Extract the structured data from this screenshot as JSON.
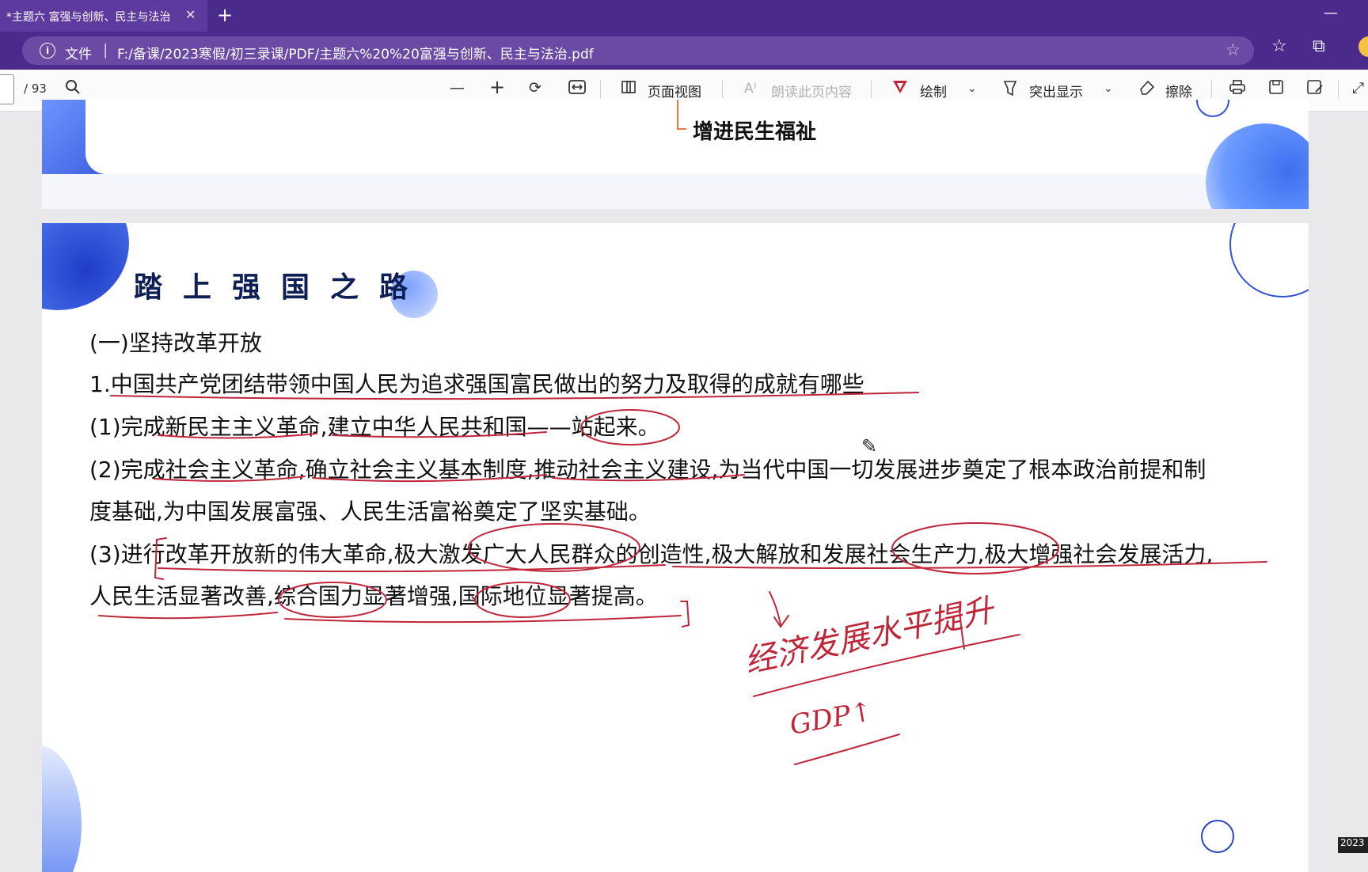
{
  "tab": {
    "title": "*主题六 富强与创新、民主与法治",
    "close": "✕",
    "new_tab": "+"
  },
  "window": {
    "minimize": "—"
  },
  "address": {
    "info": "i",
    "file_label": "文件",
    "separator": "|",
    "url": "F:/备课/2023寒假/初三录课/PDF/主题六%20%20富强与创新、民主与法治.pdf"
  },
  "toolbar": {
    "page_total": "/ 93",
    "zoom_out": "—",
    "zoom_in": "+",
    "page_view": "页面视图",
    "read_aloud": "朗读此页内容",
    "draw": "绘制",
    "highlight": "突出显示",
    "erase": "擦除"
  },
  "page1": {
    "text": "增进民生福祉"
  },
  "page2": {
    "title": "踏上强国之路",
    "lines": [
      "(一)坚持改革开放",
      "1.中国共产党团结带领中国人民为追求强国富民做出的努力及取得的成就有哪些",
      "(1)完成新民主主义革命,建立中华人民共和国——站起来。",
      "(2)完成社会主义革命,确立社会主义基本制度,推动社会主义建设,为当代中国一切发展进步奠定了根本政治前提和制",
      "度基础,为中国发展富强、人民生活富裕奠定了坚实基础。",
      "(3)进行改革开放新的伟大革命,极大激发广大人民群众的创造性,极大解放和发展社会生产力,极大增强社会发展活力,",
      "人民生活显著改善,综合国力显著增强,国际地位显著提高。"
    ]
  },
  "annotations": {
    "handwriting_1": "经济发展水平提升",
    "handwriting_2": "GDP↑"
  },
  "timestamp": "2023",
  "colors": {
    "chrome": "#4a2a8a",
    "ink": "#c0263a",
    "accent": "#1a6fd1"
  }
}
